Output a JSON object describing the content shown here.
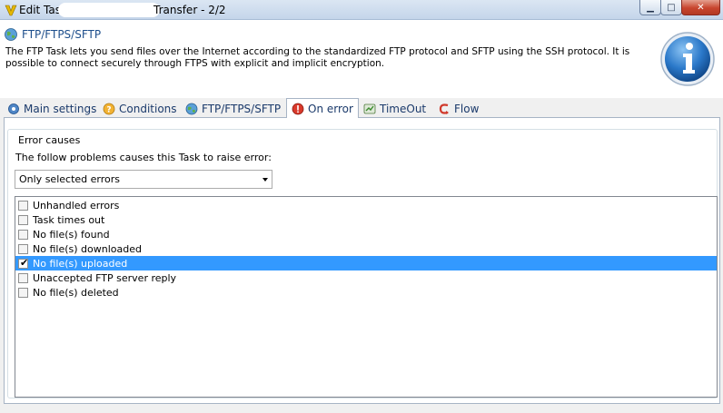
{
  "window": {
    "title_prefix": "Edit Task -",
    "title_suffix": "Transfer - 2/2",
    "minimize_icon": "minimize-icon",
    "maximize_icon": "maximize-icon",
    "close_icon": "close-icon"
  },
  "header": {
    "title": "FTP/FTPS/SFTP",
    "description": "The FTP Task lets you send files over the Internet according to the standardized FTP protocol and SFTP using the SSH protocol. It is possible to connect securely through FTPS with explicit and implicit encryption.",
    "icon": "globe-icon",
    "info_icon": "info-icon"
  },
  "tabs": [
    {
      "label": "Main settings",
      "icon": "settings-icon",
      "active": false
    },
    {
      "label": "Conditions",
      "icon": "question-icon",
      "active": false
    },
    {
      "label": "FTP/FTPS/SFTP",
      "icon": "globe-icon",
      "active": false
    },
    {
      "label": "On error",
      "icon": "error-icon",
      "active": true
    },
    {
      "label": "TimeOut",
      "icon": "timeout-icon",
      "active": false
    },
    {
      "label": "Flow",
      "icon": "flow-icon",
      "active": false
    }
  ],
  "error_causes": {
    "group_title": "Error causes",
    "prompt": "The follow problems causes this Task to raise error:",
    "dropdown_value": "Only selected errors",
    "items": [
      {
        "label": "Unhandled errors",
        "checked": false,
        "selected": false
      },
      {
        "label": "Task times out",
        "checked": false,
        "selected": false
      },
      {
        "label": "No file(s) found",
        "checked": false,
        "selected": false
      },
      {
        "label": "No file(s) downloaded",
        "checked": false,
        "selected": false
      },
      {
        "label": "No file(s) uploaded",
        "checked": true,
        "selected": true
      },
      {
        "label": "Unaccepted FTP server reply",
        "checked": false,
        "selected": false
      },
      {
        "label": "No file(s) deleted",
        "checked": false,
        "selected": false
      }
    ]
  },
  "colors": {
    "selection": "#3399ff",
    "header_title": "#1e4f8c",
    "tab_text": "#1b3a6b"
  }
}
